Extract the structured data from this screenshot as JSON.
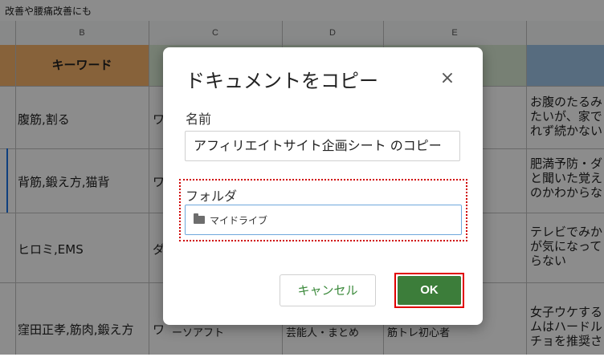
{
  "formula_bar": {
    "text": "改善や腰痛改善にも"
  },
  "columns": [
    "B",
    "C",
    "D",
    "E"
  ],
  "header_row": {
    "keyword": "キーワード"
  },
  "rows": [
    {
      "keyword": "腹筋,割る",
      "c": "ワ",
      "e_lines": [
        "お腹のたるみ",
        "たいが、家で",
        "れず続かない"
      ]
    },
    {
      "keyword": "背筋,鍛え方,猫背",
      "c": "ワ",
      "e_lines": [
        "肥満予防・ダ",
        "と聞いた覚え",
        "のかわからな"
      ]
    },
    {
      "keyword": "ヒロミ,EMS",
      "c": "ダ",
      "e_lines": [
        "テレビでみか",
        "が気になって",
        "らない"
      ]
    },
    {
      "keyword": "窪田正孝,筋肉,鍛え方",
      "c": "ワ",
      "c_tail": "ーソアフト",
      "d": "芸能人・まとめ",
      "e": "筋トレ初心者",
      "e_lines": [
        "女子ウケする",
        "ムはハードル",
        "チョを推奨さ"
      ]
    }
  ],
  "dialog": {
    "title": "ドキュメントをコピー",
    "close_glyph": "×",
    "name_label": "名前",
    "name_value": "アフィリエイトサイト企画シート のコピー",
    "folder_label": "フォルダ",
    "folder_value": "マイドライブ",
    "cancel_label": "キャンセル",
    "ok_label": "OK"
  },
  "colors": {
    "keyword_header": "#f6b26b",
    "ok_button": "#3c7d3a",
    "highlight": "#e00000",
    "folder_border": "#6fa8dc"
  }
}
